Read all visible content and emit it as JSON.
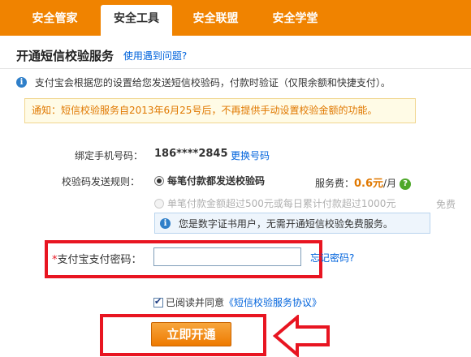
{
  "nav": {
    "tabs": [
      {
        "label": "安全管家",
        "active": false
      },
      {
        "label": "安全工具",
        "active": true
      },
      {
        "label": "安全联盟",
        "active": false
      },
      {
        "label": "安全学堂",
        "active": false
      }
    ]
  },
  "page": {
    "title": "开通短信校验服务",
    "help_link": "使用遇到问题?"
  },
  "info": {
    "text": "支付宝会根据您的设置给您发送短信校验码，付款时验证（仅限余额和快捷支付）。"
  },
  "notice": {
    "text": "通知：短信校验服务自2013年6月25号后，不再提供手动设置校验金额的功能。"
  },
  "phone": {
    "label": "绑定手机号码：",
    "value": "186****2845",
    "change_link": "更换号码"
  },
  "rules": {
    "label": "校验码发送规则：",
    "option1": {
      "text": "每笔付款都发送校验码",
      "checked": true
    },
    "fee_label": "服务费：",
    "fee_amount": "0.6元",
    "fee_unit": "/月",
    "option2": {
      "text": "单笔付款金额超过500元或每日累计付款超过1000元",
      "checked": false,
      "disabled": true
    },
    "option2_fee": "免费",
    "cert_notice": "您是数字证书用户，无需开通短信校验免费服务。"
  },
  "password": {
    "required_mark": "*",
    "label": "支付宝支付密码：",
    "value": "",
    "forgot_link": "忘记密码?"
  },
  "agreement": {
    "checked": true,
    "text": "已阅读并同意",
    "link": "《短信校验服务协议》"
  },
  "submit": {
    "label": "立即开通"
  },
  "colors": {
    "nav_bg": "#f08300",
    "link": "#0063dc",
    "highlight_red": "#e81521",
    "button_orange": "#ee7a00"
  },
  "icons": {
    "info": "info-icon",
    "help": "question-icon",
    "arrow": "left-arrow-icon"
  }
}
